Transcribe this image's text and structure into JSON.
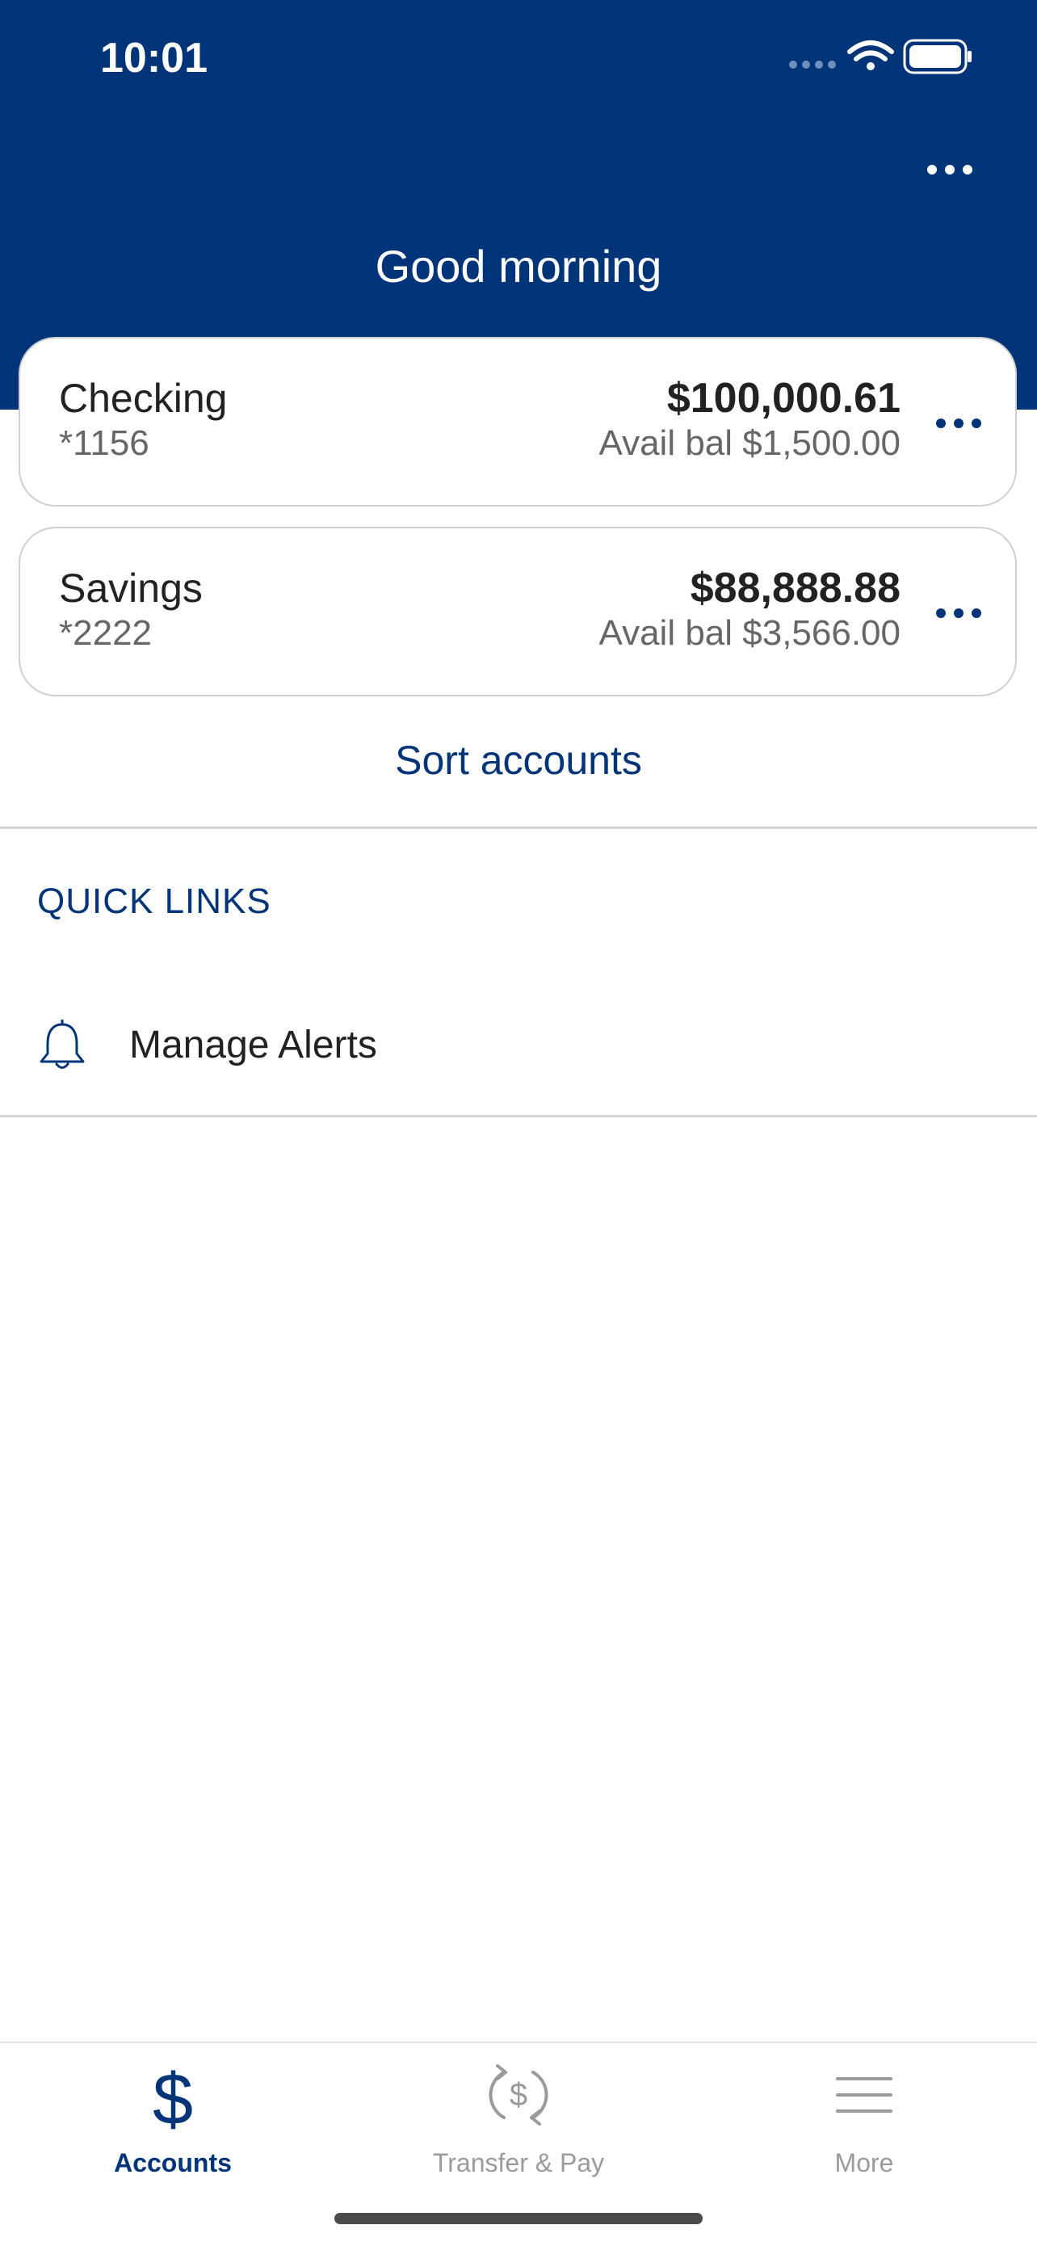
{
  "status_bar": {
    "time": "10:01"
  },
  "header": {
    "greeting": "Good morning",
    "more_icon": "ellipsis-icon",
    "background_color": "#003478"
  },
  "accounts": [
    {
      "name": "Checking",
      "number": "*1156",
      "balance": "$100,000.61",
      "available": "Avail bal $1,500.00"
    },
    {
      "name": "Savings",
      "number": "*2222",
      "balance": "$88,888.88",
      "available": "Avail bal $3,566.00"
    }
  ],
  "sort_accounts_label": "Sort accounts",
  "quick_links": {
    "title": "QUICK LINKS",
    "items": [
      {
        "label": "Manage Alerts",
        "icon": "bell-icon"
      }
    ]
  },
  "tabbar": {
    "items": [
      {
        "label": "Accounts",
        "icon": "dollar-icon",
        "active": true
      },
      {
        "label": "Transfer & Pay",
        "icon": "transfer-pay-icon",
        "active": false
      },
      {
        "label": "More",
        "icon": "menu-icon",
        "active": false
      }
    ]
  },
  "colors": {
    "brand": "#003478",
    "inactive": "#9a9a9a"
  }
}
